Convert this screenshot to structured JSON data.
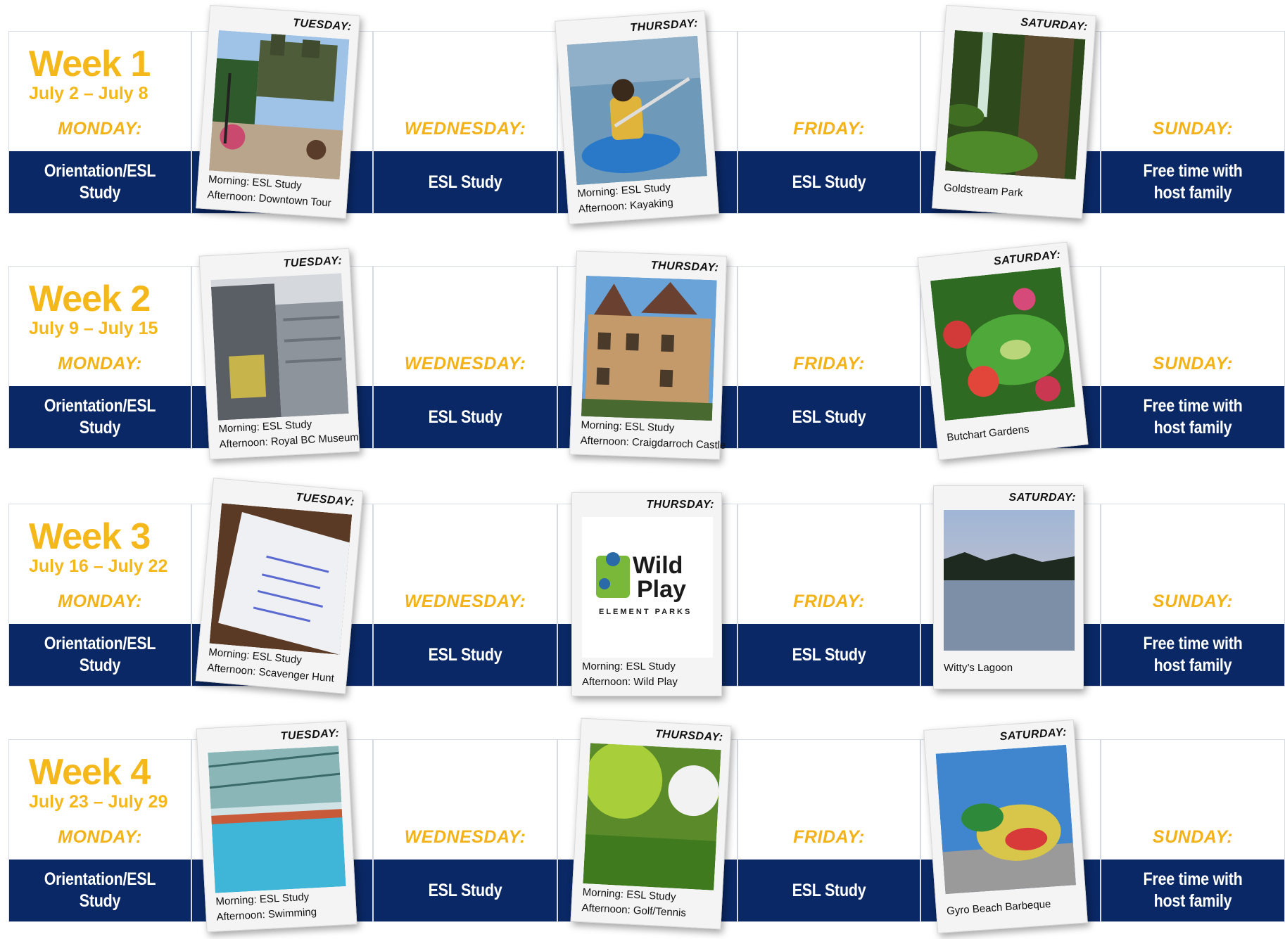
{
  "weeks": [
    {
      "title": "Week 1",
      "dates": "July 2 – July 8",
      "monday": {
        "day": "MONDAY:",
        "activity": "Orientation/ESL Study"
      },
      "tuesday": {
        "day": "TUESDAY:",
        "morning": "Morning: ESL Study",
        "afternoon": "Afternoon: Downtown Tour"
      },
      "wednesday": {
        "day": "WEDNESDAY:",
        "activity": "ESL Study"
      },
      "thursday": {
        "day": "THURSDAY:",
        "morning": "Morning: ESL Study",
        "afternoon": "Afternoon: Kayaking"
      },
      "friday": {
        "day": "FRIDAY:",
        "activity": "ESL Study"
      },
      "saturday": {
        "day": "SATURDAY:",
        "caption": "Goldstream Park"
      },
      "sunday": {
        "day": "SUNDAY:",
        "activity_line1": "Free time with",
        "activity_line2": "host family"
      }
    },
    {
      "title": "Week 2",
      "dates": "July 9 – July 15",
      "monday": {
        "day": "MONDAY:",
        "activity": "Orientation/ESL Study"
      },
      "tuesday": {
        "day": "TUESDAY:",
        "morning": "Morning: ESL Study",
        "afternoon": "Afternoon: Royal BC Museum"
      },
      "wednesday": {
        "day": "WEDNESDAY:",
        "activity": "ESL Study"
      },
      "thursday": {
        "day": "THURSDAY:",
        "morning": "Morning: ESL Study",
        "afternoon": "Afternoon: Craigdarroch Castle"
      },
      "friday": {
        "day": "FRIDAY:",
        "activity": "ESL Study"
      },
      "saturday": {
        "day": "SATURDAY:",
        "caption": "Butchart Gardens"
      },
      "sunday": {
        "day": "SUNDAY:",
        "activity_line1": "Free time with",
        "activity_line2": "host family"
      }
    },
    {
      "title": "Week 3",
      "dates": "July 16 – July 22",
      "monday": {
        "day": "MONDAY:",
        "activity": "Orientation/ESL Study"
      },
      "tuesday": {
        "day": "TUESDAY:",
        "morning": "Morning: ESL Study",
        "afternoon": "Afternoon: Scavenger Hunt"
      },
      "wednesday": {
        "day": "WEDNESDAY:",
        "activity": "ESL Study"
      },
      "thursday": {
        "day": "THURSDAY:",
        "morning": "Morning: ESL Study",
        "afternoon": "Afternoon: Wild Play"
      },
      "friday": {
        "day": "FRIDAY:",
        "activity": "ESL Study"
      },
      "saturday": {
        "day": "SATURDAY:",
        "caption": "Witty’s Lagoon"
      },
      "sunday": {
        "day": "SUNDAY:",
        "activity_line1": "Free time with",
        "activity_line2": "host family"
      }
    },
    {
      "title": "Week 4",
      "dates": "July 23 – July 29",
      "monday": {
        "day": "MONDAY:",
        "activity": "Orientation/ESL Study"
      },
      "tuesday": {
        "day": "TUESDAY:",
        "morning": "Morning: ESL Study",
        "afternoon": "Afternoon: Swimming"
      },
      "wednesday": {
        "day": "WEDNESDAY:",
        "activity": "ESL Study"
      },
      "thursday": {
        "day": "THURSDAY:",
        "morning": "Morning: ESL Study",
        "afternoon": "Afternoon: Golf/Tennis"
      },
      "friday": {
        "day": "FRIDAY:",
        "activity": "ESL Study"
      },
      "saturday": {
        "day": "SATURDAY:",
        "caption": "Gyro Beach Barbeque"
      },
      "sunday": {
        "day": "SUNDAY:",
        "activity_line1": "Free time with",
        "activity_line2": "host family"
      }
    }
  ],
  "wildplay_logo": {
    "line1": "Wild",
    "line2": "Play",
    "tagline": "ELEMENT PARKS"
  },
  "colors": {
    "navy": "#0a2865",
    "gold": "#f5b81a",
    "polaroid": "#f4f4f4"
  }
}
